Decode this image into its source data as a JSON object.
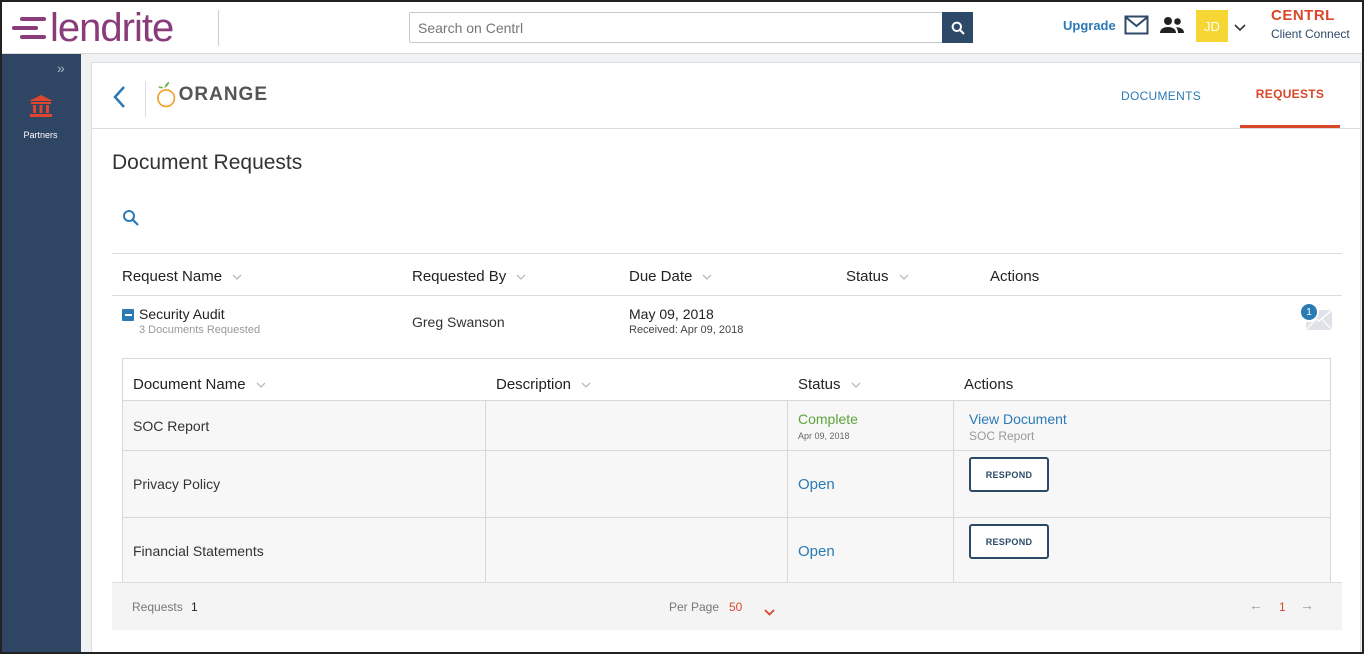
{
  "app": {
    "logo_text": "lendrite",
    "search_placeholder": "Search on Centrl",
    "upgrade_label": "Upgrade",
    "avatar_initials": "JD",
    "brand_name": "CENTRL",
    "brand_sub": "Client Connect"
  },
  "sidebar": {
    "items": [
      {
        "label": "Partners",
        "icon": "bank-icon"
      }
    ]
  },
  "partner": {
    "logo_text": "ORANGE"
  },
  "tabs": [
    {
      "label": "DOCUMENTS",
      "active": false
    },
    {
      "label": "REQUESTS",
      "active": true
    }
  ],
  "page": {
    "title": "Document Requests"
  },
  "requests_table": {
    "columns": [
      "Request Name",
      "Requested By",
      "Due Date",
      "Status",
      "Actions"
    ],
    "rows": [
      {
        "name": "Security Audit",
        "subtitle": "3 Documents Requested",
        "requested_by": "Greg Swanson",
        "due_date": "May 09, 2018",
        "received": "Received: Apr 09, 2018",
        "message_count": "1"
      }
    ]
  },
  "documents_table": {
    "columns": [
      "Document Name",
      "Description",
      "Status",
      "Actions"
    ],
    "rows": [
      {
        "name": "SOC Report",
        "description": "",
        "status": "Complete",
        "status_date": "Apr 09, 2018",
        "action": "View Document",
        "action_sub": "SOC Report"
      },
      {
        "name": "Privacy Policy",
        "description": "",
        "status": "Open",
        "action": "RESPOND"
      },
      {
        "name": "Financial Statements",
        "description": "",
        "status": "Open",
        "action": "RESPOND"
      }
    ]
  },
  "footer": {
    "requests_label": "Requests",
    "requests_count": "1",
    "per_page_label": "Per Page",
    "per_page_value": "50",
    "prev_arrow": "←",
    "current_page": "1",
    "next_arrow": "→"
  },
  "colors": {
    "brand_purple": "#8a3c7a",
    "sidebar_bg": "#2e4564",
    "link_blue": "#2a7ab5",
    "accent_red": "#d9472b",
    "complete_green": "#5aa43a"
  }
}
